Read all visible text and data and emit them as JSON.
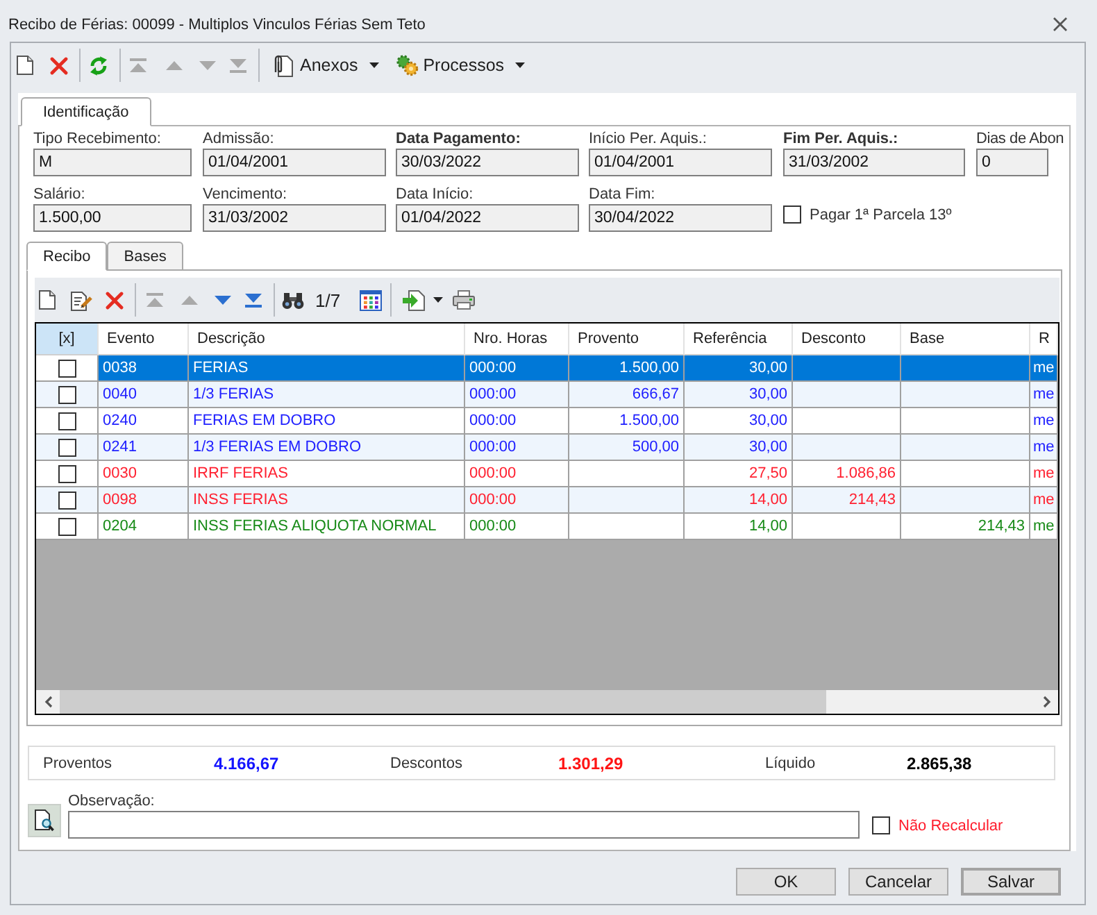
{
  "window": {
    "title": "Recibo de Férias: 00099 - Multiplos Vinculos Férias Sem Teto"
  },
  "toolbar": {
    "navigation": [
      {
        "disabled": true
      },
      {
        "disabled": true
      },
      {
        "disabled": true
      },
      {
        "disabled": true
      }
    ],
    "menus": [
      {
        "label": "Anexos"
      },
      {
        "label": "Processos"
      }
    ]
  },
  "tabs": [
    {
      "label": "Identificação",
      "selected": true
    }
  ],
  "field_rows": [
    [
      {
        "kind": "text",
        "label": "Tipo Recebimento:",
        "value": "M",
        "required": false
      },
      {
        "kind": "text",
        "label": "Admissão:",
        "value": "01/04/2001",
        "required": false
      },
      {
        "kind": "text",
        "label": "Data Pagamento:",
        "value": "30/03/2022",
        "required": true
      },
      {
        "kind": "text",
        "label": "Início Per. Aquis.:",
        "value": "01/04/2001",
        "required": false
      },
      {
        "kind": "text",
        "label": "Fim Per. Aquis.:",
        "value": "31/03/2002",
        "required": true
      },
      {
        "kind": "text",
        "label": "Dias de Abon",
        "value": "0",
        "required": false
      }
    ],
    [
      {
        "kind": "text",
        "label": "Salário:",
        "value": "1.500,00",
        "required": false
      },
      {
        "kind": "text",
        "label": "Vencimento:",
        "value": "31/03/2002",
        "required": false
      },
      {
        "kind": "text",
        "label": "Data Início:",
        "value": "01/04/2022",
        "required": false
      },
      {
        "kind": "text",
        "label": "Data Fim:",
        "value": "30/04/2022",
        "required": false
      },
      {
        "kind": "checkbox",
        "label": "Pagar 1ª Parcela 13º",
        "checked": false
      }
    ]
  ],
  "subtabs": [
    {
      "label": "Recibo",
      "selected": true
    },
    {
      "label": "Bases",
      "selected": false
    }
  ],
  "grid_toolbar": {
    "navigation": [
      {
        "disabled": true
      },
      {
        "disabled": true
      },
      {
        "disabled": false
      },
      {
        "disabled": false
      }
    ],
    "record_counter": "1/7"
  },
  "table": {
    "columns": [
      "[x]",
      "Evento",
      "Descrição",
      "Nro. Horas",
      "Provento",
      "Referência",
      "Desconto",
      "Base",
      "R"
    ],
    "rows": [
      {
        "selected": true,
        "checked": false,
        "kind": "earning",
        "evento": "0038",
        "descricao": "FERIAS",
        "nro_horas": "000:00",
        "provento": "1.500,00",
        "referencia": "30,00",
        "column_9": "me"
      },
      {
        "selected": false,
        "checked": false,
        "kind": "earning",
        "evento": "0040",
        "descricao": "1/3 FERIAS",
        "nro_horas": "000:00",
        "provento": "666,67",
        "referencia": "30,00",
        "column_9": "me"
      },
      {
        "selected": false,
        "checked": false,
        "kind": "earning",
        "evento": "0240",
        "descricao": "FERIAS EM DOBRO",
        "nro_horas": "000:00",
        "provento": "1.500,00",
        "referencia": "30,00",
        "column_9": "me"
      },
      {
        "selected": false,
        "checked": false,
        "kind": "earning",
        "evento": "0241",
        "descricao": "1/3 FERIAS EM DOBRO",
        "nro_horas": "000:00",
        "provento": "500,00",
        "referencia": "30,00",
        "column_9": "me"
      },
      {
        "selected": false,
        "checked": false,
        "kind": "deduction",
        "evento": "0030",
        "descricao": "IRRF FERIAS",
        "nro_horas": "000:00",
        "referencia": "27,50",
        "desconto": "1.086,86",
        "column_9": "me"
      },
      {
        "selected": false,
        "checked": false,
        "kind": "deduction",
        "evento": "0098",
        "descricao": "INSS FERIAS",
        "nro_horas": "000:00",
        "referencia": "14,00",
        "desconto": "214,43",
        "column_9": "me"
      },
      {
        "selected": false,
        "checked": false,
        "kind": "base",
        "evento": "0204",
        "descricao": "INSS FERIAS ALIQUOTA NORMAL",
        "nro_horas": "000:00",
        "referencia": "14,00",
        "base": "214,43",
        "column_9": "me"
      }
    ]
  },
  "totals": [
    {
      "label": "Proventos",
      "value": "4.166,67",
      "kind": "earning"
    },
    {
      "label": "Descontos",
      "value": "1.301,29",
      "kind": "deduction"
    },
    {
      "label": "Líquido",
      "value": "2.865,38",
      "kind": "net"
    }
  ],
  "observation": {
    "label": "Observação:"
  },
  "recalculate_option": {
    "label": "Não Recalcular",
    "checked": false
  },
  "buttons": [
    {
      "label": "OK",
      "default": false
    },
    {
      "label": "Cancelar",
      "default": false
    },
    {
      "label": "Salvar",
      "default": true
    }
  ]
}
